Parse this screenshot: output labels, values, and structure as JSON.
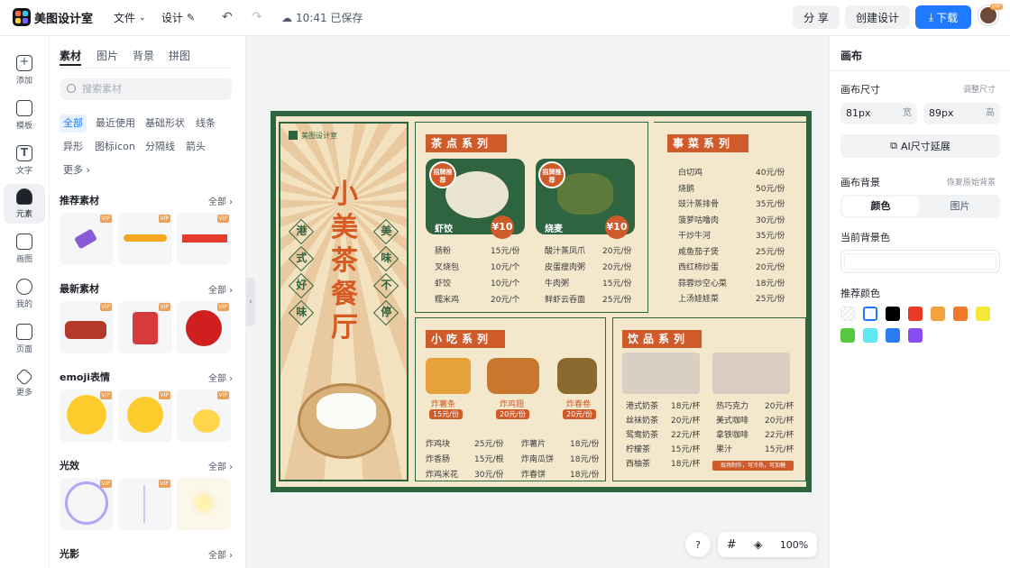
{
  "app": {
    "brand": "美图设计室",
    "menu_file": "文件",
    "menu_design": "设计",
    "save_status": "10:41 已保存"
  },
  "header_actions": {
    "share": "分 享",
    "create": "创建设计",
    "download": "下载",
    "avatar_badge": "VIP"
  },
  "rail": [
    "添加",
    "模板",
    "文字",
    "元素",
    "画图",
    "我的",
    "页面",
    "更多"
  ],
  "panel": {
    "tabs": [
      "素材",
      "图片",
      "背景",
      "拼图"
    ],
    "search_placeholder": "搜索素材",
    "chips": [
      "全部",
      "最近使用",
      "基础形状",
      "线条",
      "异形",
      "图标icon",
      "分隔线",
      "箭头",
      "更多"
    ],
    "sections": [
      {
        "title": "推荐素材",
        "all": "全部"
      },
      {
        "title": "最新素材",
        "all": "全部"
      },
      {
        "title": "emoji表情",
        "all": "全部"
      },
      {
        "title": "光效",
        "all": "全部"
      },
      {
        "title": "光影",
        "all": "全部"
      }
    ],
    "vip": "VIP"
  },
  "right_panel": {
    "title": "画布",
    "size_label": "画布尺寸",
    "size_link": "调整尺寸",
    "width_value": "81px",
    "width_unit": "宽",
    "height_value": "89px",
    "height_unit": "高",
    "ai_extend": "AI尺寸延展",
    "bg_label": "画布背景",
    "bg_reset": "恢复原始背景",
    "bg_tab_color": "颜色",
    "bg_tab_image": "图片",
    "current_bg": "当前背景色",
    "recommend": "推荐颜色",
    "swatches": [
      "#ffffff",
      "#ffffff",
      "#000000",
      "#e83a26",
      "#f4a340",
      "#f07a2a",
      "#f6e83a",
      "#54c940",
      "#5ee8ef",
      "#2b7cf2",
      "#8a4cf3"
    ]
  },
  "bottom": {
    "help": "?",
    "zoom": "100%"
  },
  "menu": {
    "brand": "美图设计室",
    "title": [
      "小",
      "美",
      "茶",
      "餐",
      "厅"
    ],
    "side_left": [
      "港",
      "式",
      "好",
      "味"
    ],
    "side_right": [
      "美",
      "味",
      "不",
      "停"
    ],
    "tea_title": "茶点系列",
    "tea_badge": "招牌推荐",
    "tea_items": [
      {
        "name": "虾饺",
        "price": "¥10"
      },
      {
        "name": "烧麦",
        "price": "¥10"
      }
    ],
    "tea_list": [
      [
        "肠粉",
        "15元/份",
        "酸汁蒸凤爪",
        "20元/份"
      ],
      [
        "叉烧包",
        "10元/个",
        "皮蛋瘦肉粥",
        "20元/份"
      ],
      [
        "虾饺",
        "10元/个",
        "牛肉粥",
        "15元/份"
      ],
      [
        "糯米鸡",
        "20元/个",
        "鲜虾云吞面",
        "25元/份"
      ]
    ],
    "signature_title": "事菜系列",
    "signature_list": [
      [
        "白切鸡",
        "40元/份"
      ],
      [
        "烧鹅",
        "50元/份"
      ],
      [
        "豉汁蒸排骨",
        "35元/份"
      ],
      [
        "菠萝咕噜肉",
        "30元/份"
      ],
      [
        "干炒牛河",
        "35元/份"
      ],
      [
        "咸鱼茄子煲",
        "25元/份"
      ],
      [
        "西红柿炒蛋",
        "20元/份"
      ],
      [
        "蒜蓉炒空心菜",
        "18元/份"
      ],
      [
        "上汤娃娃菜",
        "25元/份"
      ]
    ],
    "snack_title": "小吃系列",
    "snack_items": [
      {
        "name": "炸薯条",
        "price": "15元/份"
      },
      {
        "name": "炸鸡翅",
        "price": "20元/份"
      },
      {
        "name": "炸春卷",
        "price": "20元/份"
      }
    ],
    "snack_list": [
      [
        "炸鸡块",
        "25元/份",
        "炸薯片",
        "18元/份"
      ],
      [
        "炸香肠",
        "15元/根",
        "炸南瓜饼",
        "18元/份"
      ],
      [
        "炸鸡米花",
        "30元/份",
        "炸春饼",
        "18元/份"
      ]
    ],
    "drink_title": "饮品系列",
    "drink_list": [
      [
        "港式奶茶",
        "18元/杯",
        "热巧克力",
        "20元/杯"
      ],
      [
        "丝袜奶茶",
        "20元/杯",
        "美式咖啡",
        "20元/杯"
      ],
      [
        "鸳鸯奶茶",
        "22元/杯",
        "拿铁咖啡",
        "22元/杯"
      ],
      [
        "柠檬茶",
        "15元/杯",
        "果汁",
        "15元/杯"
      ],
      [
        "西柚茶",
        "18元/杯"
      ]
    ],
    "drink_note": "现场制作，可冷热，可加糖"
  }
}
